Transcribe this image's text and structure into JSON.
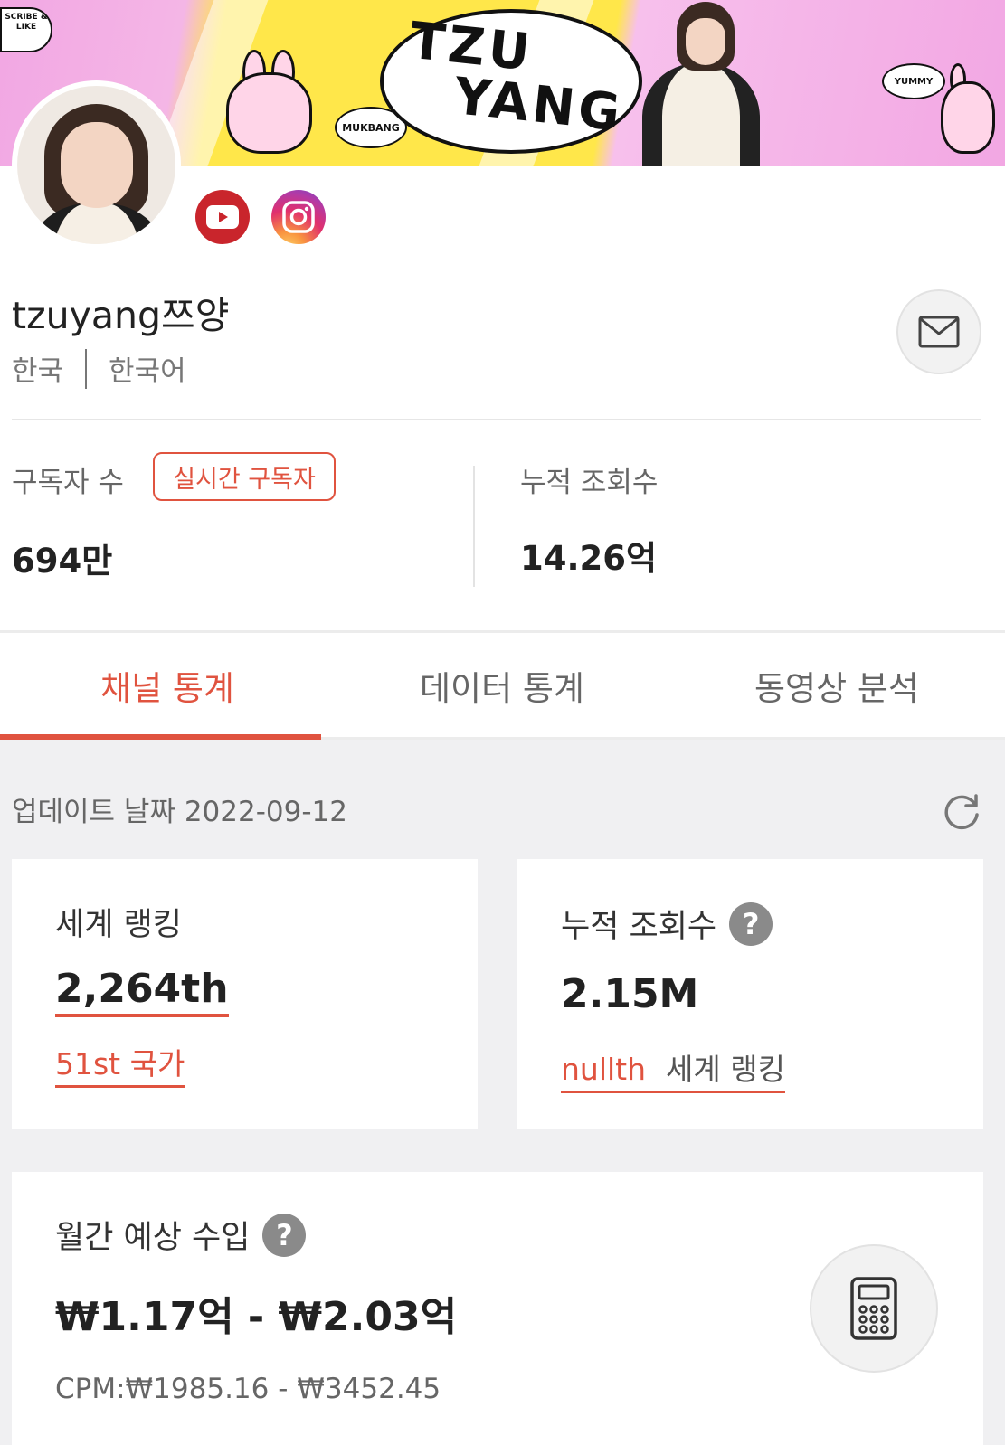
{
  "banner": {
    "logo_line1": "TZU",
    "logo_line2": "YANG",
    "bubble_mukbang": "MUKBANG",
    "bubble_yummy": "YUMMY",
    "subscribe_text": "SCRIBE & LIKE"
  },
  "profile": {
    "channel_name": "tzuyang쯔양",
    "country": "한국",
    "language": "한국어"
  },
  "stats": {
    "subscribers_label": "구독자 수",
    "realtime_badge": "실시간 구독자",
    "subscribers_value": "694만",
    "views_label": "누적 조회수",
    "views_value": "14.26억"
  },
  "tabs": [
    {
      "label": "채널 통계",
      "active": true
    },
    {
      "label": "데이터 통계",
      "active": false
    },
    {
      "label": "동영상 분석",
      "active": false
    }
  ],
  "update": {
    "text": "업데이트 날짜 2022-09-12"
  },
  "cards": {
    "world_rank": {
      "title": "세계 랭킹",
      "value": "2,264th",
      "country_rank": "51st 국가"
    },
    "views": {
      "title": "누적 조회수",
      "value": "2.15M",
      "rank_prefix": "nullth",
      "rank_suffix": "세계 랭킹"
    },
    "income": {
      "title": "월간 예상 수입",
      "value": "₩1.17억 - ₩2.03억",
      "cpm": "CPM:₩1985.16 - ₩3452.45"
    }
  },
  "colors": {
    "accent": "#e0533f",
    "youtube": "#c9252c"
  },
  "icons": {
    "youtube": "youtube-icon",
    "instagram": "instagram-icon",
    "mail": "mail-icon",
    "refresh": "refresh-icon",
    "help": "question-icon",
    "calculator": "calculator-icon"
  }
}
